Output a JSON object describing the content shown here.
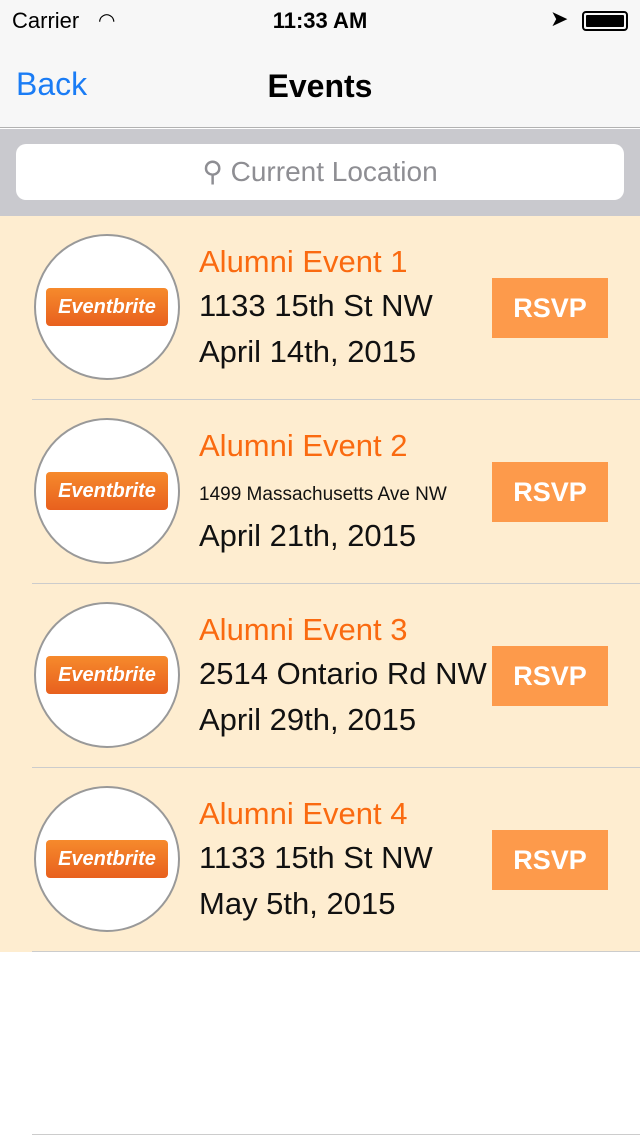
{
  "status": {
    "carrier": "Carrier",
    "time": "11:33 AM"
  },
  "nav": {
    "back": "Back",
    "title": "Events"
  },
  "search": {
    "placeholder": "Current Location"
  },
  "logo_text": "Eventbrite",
  "events": [
    {
      "name": "Alumni Event 1",
      "address": "1133 15th St NW",
      "date": "April 14th, 2015",
      "rsvp": "RSVP"
    },
    {
      "name": "Alumni Event 2",
      "address": "1499 Massachusetts Ave NW",
      "date": "April 21th, 2015",
      "rsvp": "RSVP"
    },
    {
      "name": "Alumni Event 3",
      "address": "2514 Ontario Rd NW",
      "date": "April 29th, 2015",
      "rsvp": "RSVP"
    },
    {
      "name": "Alumni Event 4",
      "address": "1133 15th St NW",
      "date": "May 5th, 2015",
      "rsvp": "RSVP"
    }
  ],
  "colors": {
    "accent": "#fa6a10",
    "row_bg": "#feedd0",
    "rsvp_bg": "#fd9a4b",
    "link": "#1a7cf5"
  }
}
